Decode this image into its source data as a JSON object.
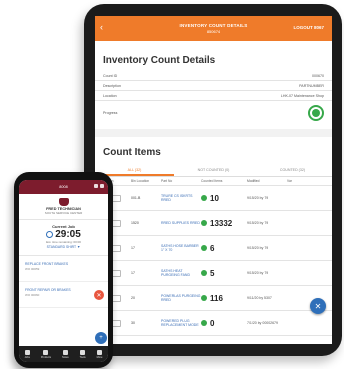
{
  "tablet": {
    "header": {
      "back_icon": "chevron-left-icon",
      "title": "INVENTORY COUNT DETAILS",
      "subtitle": "850674",
      "logout_label": "LOGOUT 8067"
    },
    "details_title": "Inventory Count Details",
    "details": [
      {
        "label": "Count ID",
        "value": "000670"
      },
      {
        "label": "Description",
        "value": "PARTNUMBER"
      },
      {
        "label": "Location",
        "value": "LHK-07 Maintenance Shop"
      }
    ],
    "progress_label": "Progress",
    "count_items_title": "Count Items",
    "tabs": [
      "ALL (32)",
      "NOT COUNTED (0)",
      "COUNTED (32)"
    ],
    "columns": [
      "Qty On",
      "Bin Location",
      "Part No",
      "Counted Items",
      "Modified",
      "Var"
    ],
    "rows": [
      {
        "loc": "001-B",
        "part": "TRURE CS ISKRTS RRED",
        "count": "10",
        "modified": "9/15/20 by 79"
      },
      {
        "loc": "1520",
        "part": "RRED SUPPLIES RRED",
        "count": "13332",
        "modified": "9/15/20 by 79"
      },
      {
        "loc": "17",
        "part": "SATHS HOSE BARBER 1\" X 70",
        "count": "6",
        "modified": "9/15/20 by 79"
      },
      {
        "loc": "17",
        "part": "SATHS HEAT PURGEING FAND",
        "count": "5",
        "modified": "9/15/20 by 79"
      },
      {
        "loc": "20",
        "part": "POWERLAS PURGEING RRED",
        "count": "116",
        "modified": "9/11/20 by 5307"
      },
      {
        "loc": "30",
        "part": "POWERED PLUG REPLACEMENT MODE",
        "count": "0",
        "modified": "7/1/20 by 00002679"
      }
    ],
    "fab_icon": "wrench-icon"
  },
  "phone": {
    "header_title": "8008",
    "company_name": "FRED TECHNICIAN",
    "company_sub": "SOUTH SERVICE CENTER",
    "job_label": "Current Job",
    "timer": "29:05",
    "job_sub": "Est. time remaining: 00:00",
    "job_link": "STANDARD SHIRT ▼",
    "entries": [
      {
        "title": "REPLACE FRONT BRAKES",
        "sub": "WO 00059"
      },
      {
        "title": "FRONT REPAIR OR BRAKES",
        "sub": "WO 00060"
      }
    ],
    "tabbar": [
      "Jobs",
      "Products",
      "Notes",
      "Tools",
      "More"
    ]
  },
  "colors": {
    "tablet_header": "#ef7b2a",
    "phone_header": "#7d1c2d",
    "accent_blue": "#2f6fb9",
    "status_green": "#37a84a"
  }
}
